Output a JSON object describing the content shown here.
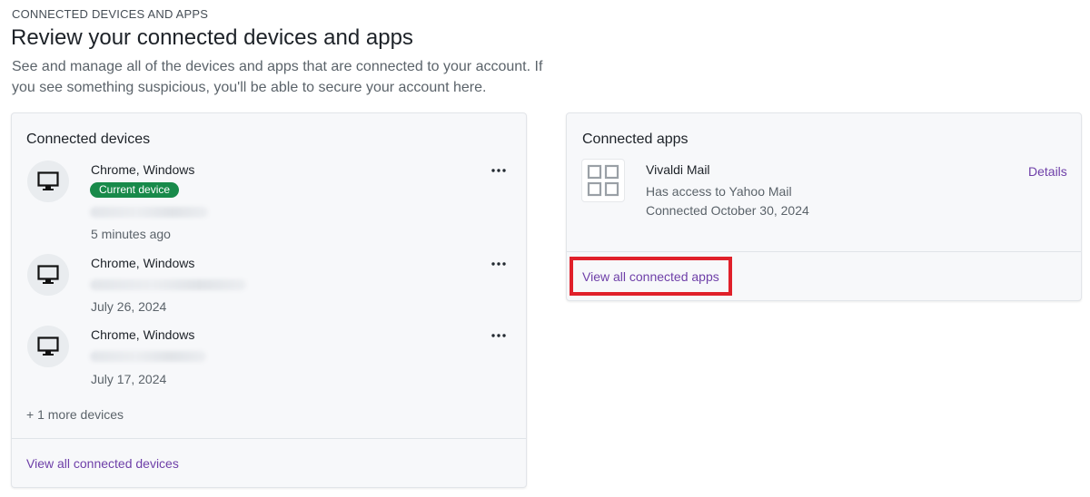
{
  "header": {
    "eyebrow": "CONNECTED DEVICES AND APPS",
    "title": "Review your connected devices and apps",
    "description": "See and manage all of the devices and apps that are connected to your account. If you see something suspicious, you'll be able to secure your account here."
  },
  "devices_card": {
    "title": "Connected devices",
    "devices": [
      {
        "name": "Chrome, Windows",
        "badge": "Current device",
        "last_active": "5 minutes ago",
        "icon": "desktop-icon"
      },
      {
        "name": "Chrome, Windows",
        "last_active": "July 26, 2024",
        "icon": "desktop-icon"
      },
      {
        "name": "Chrome, Windows",
        "last_active": "July 17, 2024",
        "icon": "desktop-icon"
      }
    ],
    "more_devices": "+ 1 more devices",
    "view_all_link": "View all connected devices"
  },
  "apps_card": {
    "title": "Connected apps",
    "apps": [
      {
        "name": "Vivaldi Mail",
        "access": "Has access to Yahoo Mail",
        "connected": "Connected October 30, 2024",
        "details_link": "Details",
        "icon": "app-grid-icon"
      }
    ],
    "view_all_link": "View all connected apps"
  },
  "colors": {
    "link": "#6e3fa8",
    "badge": "#188a4a",
    "highlight": "#e0202a"
  }
}
